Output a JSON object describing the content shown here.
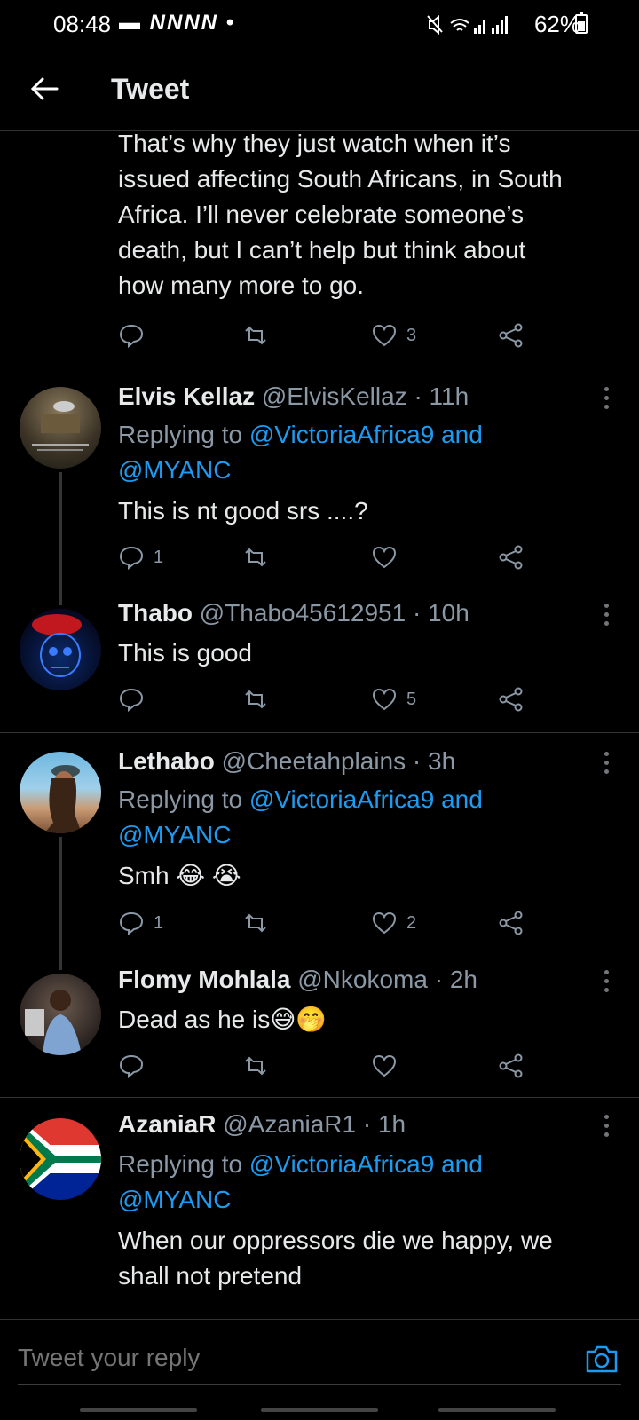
{
  "status_bar": {
    "time": "08:48",
    "notif_icons": "NNNN",
    "battery": "62%",
    "battery_level": 0.62
  },
  "header": {
    "title": "Tweet"
  },
  "first_tweet": {
    "text_lines": [
      "That’s why they just watch when it’s",
      "issued affecting South Africans, in South",
      "Africa. I’ll never celebrate someone’s",
      "death, but I can’t help but think about",
      "how many more to go."
    ],
    "likes": "3"
  },
  "replies": [
    {
      "name": "Elvis Kellaz",
      "handle": "@ElvisKellaz · 11h",
      "replying_prefix": "Replying to ",
      "replying_mention1": "@VictoriaAfrica9 and",
      "replying_mention2": "@MYANC",
      "text": "This is nt good srs ....?",
      "replies": "1",
      "likes": ""
    },
    {
      "name": "Thabo",
      "handle": "@Thabo45612951 · 10h",
      "text": "This is good",
      "replies": "",
      "likes": "5"
    },
    {
      "name": "Lethabo",
      "handle": "@Cheetahplains · 3h",
      "replying_prefix": "Replying to ",
      "replying_mention1": "@VictoriaAfrica9 and",
      "replying_mention2": "@MYANC",
      "text": "Smh 😂 😭",
      "replies": "1",
      "likes": "2"
    },
    {
      "name": "Flomy Mohlala",
      "handle": "@Nkokoma · 2h",
      "text": "Dead as he is😅🤭",
      "replies": "",
      "likes": ""
    },
    {
      "name": "AzaniaR",
      "handle": "@AzaniaR1 · 1h",
      "replying_prefix": "Replying to ",
      "replying_mention1": "@VictoriaAfrica9 and",
      "replying_mention2": "@MYANC",
      "text_lines": [
        "When our oppressors die we happy, we",
        "shall not pretend"
      ]
    }
  ],
  "reply_bar": {
    "placeholder": "Tweet your reply"
  },
  "colors": {
    "accent": "#1d9bf0",
    "background": "#000000",
    "muted": "#8b98a5"
  }
}
